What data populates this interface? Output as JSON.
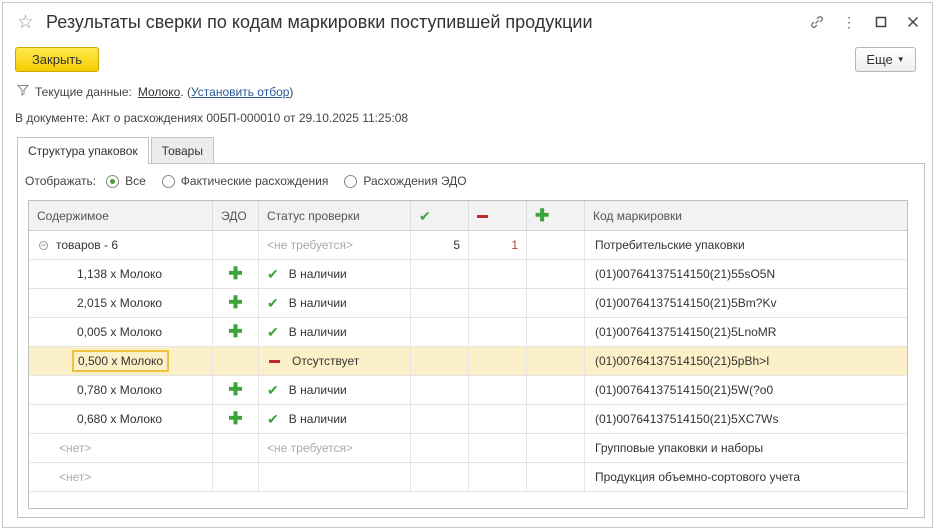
{
  "window": {
    "title": "Результаты сверки по кодам маркировки поступившей продукции"
  },
  "toolbar": {
    "close_label": "Закрыть",
    "more_label": "Еще"
  },
  "filter": {
    "prefix": "Текущие данные:",
    "value": "Молоко",
    "paren_open": ". (",
    "set_filter_link": "Установить отбор",
    "paren_close": ")"
  },
  "document": {
    "label": "В документе:",
    "value": "Акт о расхождениях 00БП-000010 от 29.10.2025 11:25:08"
  },
  "tabs": [
    {
      "label": "Структура упаковок",
      "active": true
    },
    {
      "label": "Товары",
      "active": false
    }
  ],
  "display": {
    "label": "Отображать:",
    "options": [
      {
        "label": "Все",
        "selected": true
      },
      {
        "label": "Фактические расхождения",
        "selected": false
      },
      {
        "label": "Расхождения ЭДО",
        "selected": false
      }
    ]
  },
  "table": {
    "headers": {
      "content": "Содержимое",
      "edo": "ЭДО",
      "status": "Статус проверки",
      "code": "Код маркировки"
    },
    "group": {
      "content": "товаров - 6",
      "status": "<не требуется>",
      "found": "5",
      "missing": "1",
      "code": "Потребительские упаковки"
    },
    "rows": [
      {
        "content": "1,138 х Молоко",
        "edo": true,
        "status": "В наличии",
        "status_type": "ok",
        "code": "(01)00764137514150(21)55sO5N",
        "selected": false
      },
      {
        "content": "2,015 х Молоко",
        "edo": true,
        "status": "В наличии",
        "status_type": "ok",
        "code": "(01)00764137514150(21)5Bm?Kv",
        "selected": false
      },
      {
        "content": "0,005 х Молоко",
        "edo": true,
        "status": "В наличии",
        "status_type": "ok",
        "code": "(01)00764137514150(21)5LnoMR",
        "selected": false
      },
      {
        "content": "0,500 х Молоко",
        "edo": false,
        "status": "Отсутствует",
        "status_type": "missing",
        "code": "(01)00764137514150(21)5pBh>I",
        "selected": true
      },
      {
        "content": "0,780 х Молоко",
        "edo": true,
        "status": "В наличии",
        "status_type": "ok",
        "code": "(01)00764137514150(21)5W(?o0",
        "selected": false
      },
      {
        "content": "0,680 х Молоко",
        "edo": true,
        "status": "В наличии",
        "status_type": "ok",
        "code": "(01)00764137514150(21)5XC7Ws",
        "selected": false
      }
    ],
    "footer_rows": [
      {
        "content": "<нет>",
        "status": "<не требуется>",
        "code": "Групповые упаковки и наборы"
      },
      {
        "content": "<нет>",
        "status": "",
        "code": "Продукция объемно-сортового учета"
      }
    ]
  },
  "colors": {
    "accent_yellow": "#f4cc00",
    "ok_green": "#3aa33a",
    "missing_red": "#c0282d",
    "selected_row": "#fbf0c7"
  }
}
